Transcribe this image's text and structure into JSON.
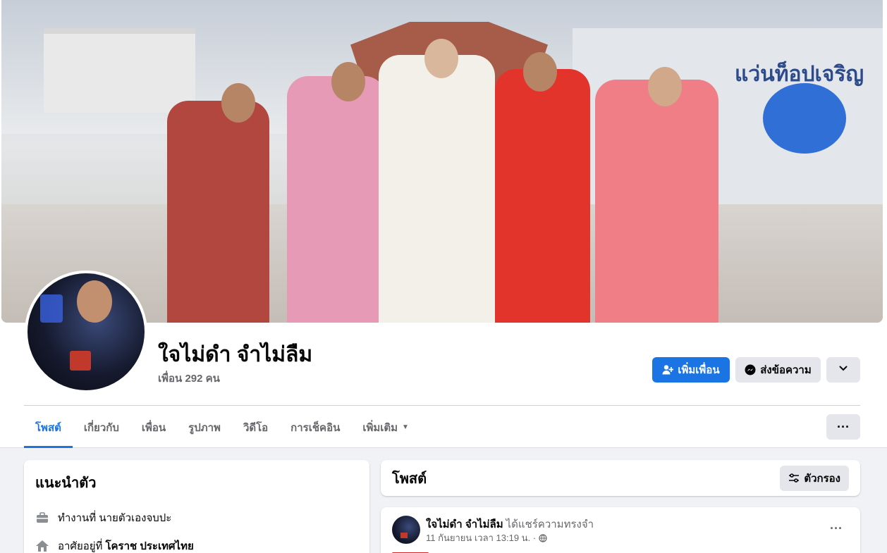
{
  "profile": {
    "name": "ใจไม่ดำ จำไม่ลืม",
    "friends": "เพื่อน 292 คน",
    "cover_sign_text": "แว่นท็อปเจริญ"
  },
  "actions": {
    "add_friend": "เพิ่มเพื่อน",
    "message": "ส่งข้อความ"
  },
  "tabs": [
    {
      "label": "โพสต์",
      "active": true
    },
    {
      "label": "เกี่ยวกับ",
      "active": false
    },
    {
      "label": "เพื่อน",
      "active": false
    },
    {
      "label": "รูปภาพ",
      "active": false
    },
    {
      "label": "วิดีโอ",
      "active": false
    },
    {
      "label": "การเช็คอิน",
      "active": false
    },
    {
      "label": "เพิ่มเติม",
      "active": false
    }
  ],
  "intro": {
    "title": "แนะนำตัว",
    "work_prefix": "ทำงานที่ นายตัวเองจบปะ",
    "home_prefix": "อาศัยอยู่ที่",
    "home_value": "โคราช ประเทศไทย"
  },
  "posts": {
    "title": "โพสต์",
    "filter_label": "ตัวกรอง"
  },
  "post": {
    "author": "ใจไม่ดำ จำไม่ลืม",
    "action": "ได้แชร์ความทรงจำ",
    "timestamp": "11 กันยายน เวลา 13:19 น. ·"
  },
  "colors": {
    "primary": "#1b74e4",
    "secondary_button": "#e4e6eb",
    "page_bg": "#f0f2f5",
    "text_secondary": "#65676b"
  }
}
